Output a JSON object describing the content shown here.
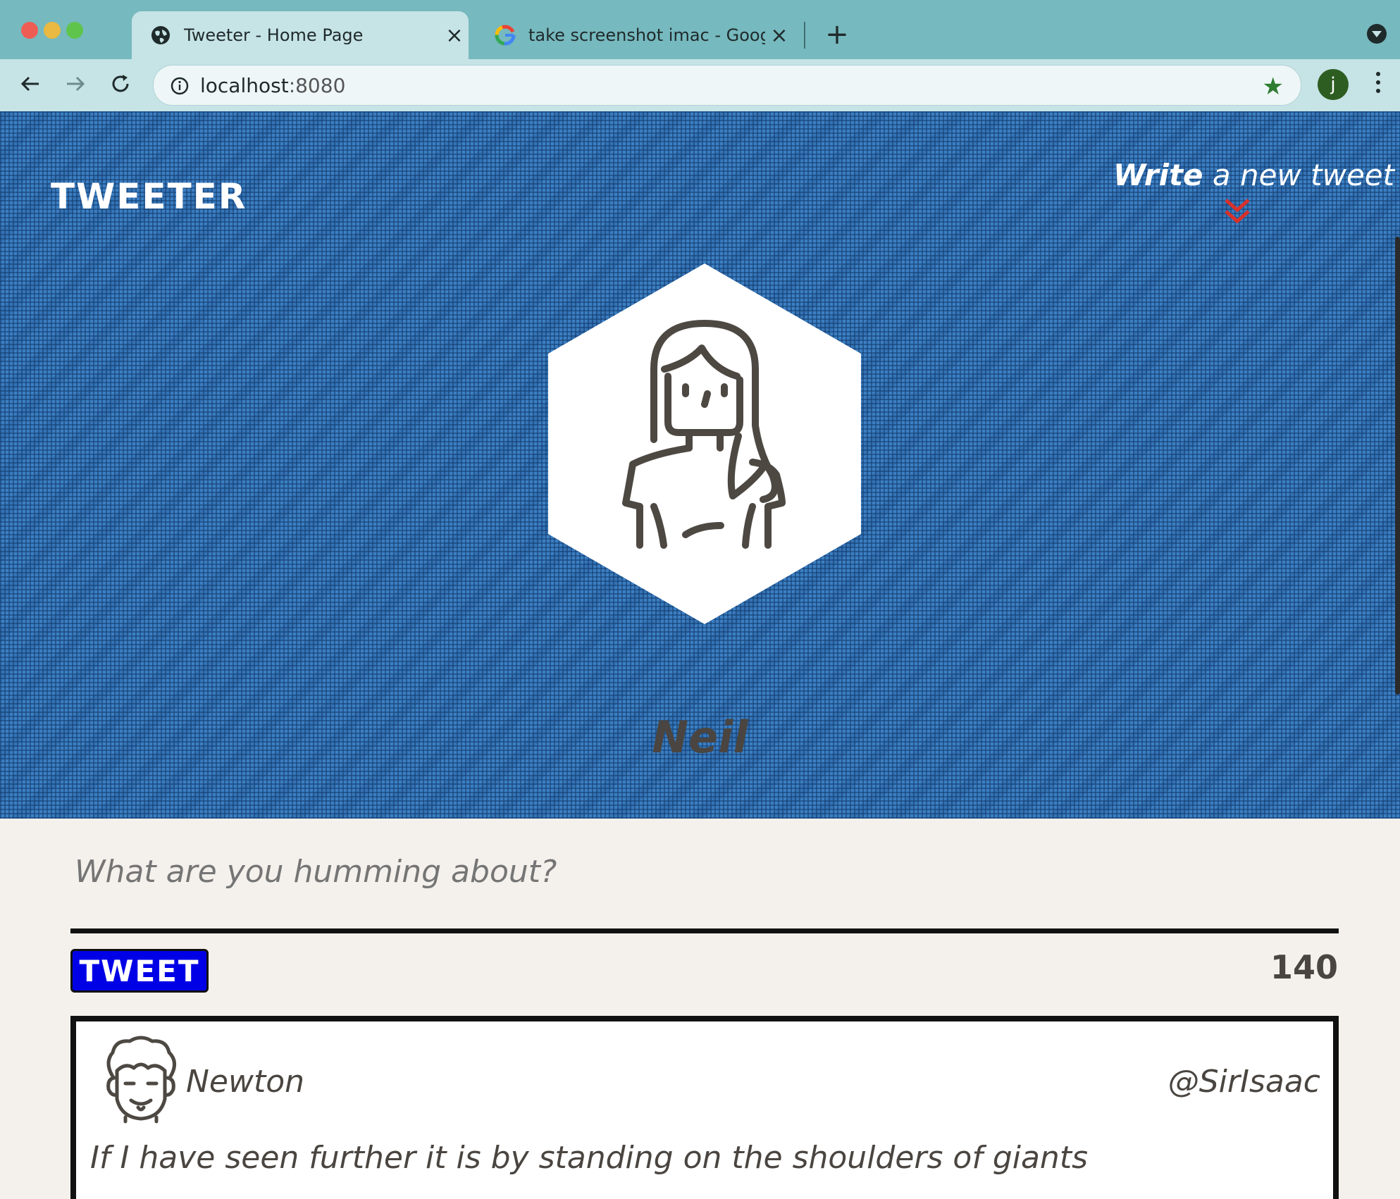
{
  "browser": {
    "tabs": [
      {
        "title": "Tweeter - Home Page",
        "icon": "globe-icon",
        "active": true
      },
      {
        "title": "take screenshot imac - Google",
        "icon": "google-icon",
        "active": false
      }
    ],
    "url_host": "localhost",
    "url_port": ":8080",
    "profile_initial": "j"
  },
  "nav": {
    "brand": "TWEETER",
    "write_bold": "Write",
    "write_rest": " a new tweet"
  },
  "profile": {
    "name": "Neil",
    "avatar_icon": "girl-avatar-icon"
  },
  "compose": {
    "placeholder": "What are you humming about?",
    "button_label": "TWEET",
    "counter": "140"
  },
  "tweets": [
    {
      "name": "Newton",
      "handle": "@SirIsaac",
      "content": "If I have seen further it is by standing on the shoulders of giants",
      "avatar_icon": "newton-avatar-icon"
    }
  ],
  "colors": {
    "header_blue": "#3b7fc3",
    "tweet_button": "#0000e6",
    "accent_red": "#d9302a",
    "text_dark": "#4a4540"
  }
}
